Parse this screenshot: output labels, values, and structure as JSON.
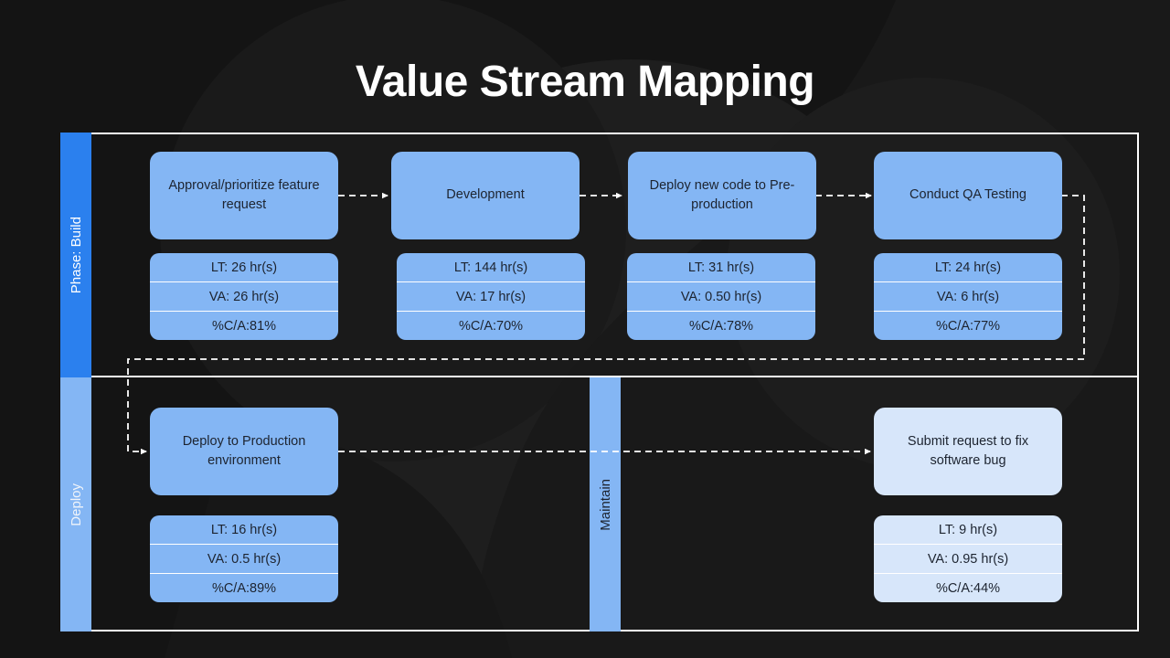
{
  "title": "Value Stream Mapping",
  "colors": {
    "background": "#141414",
    "band_build": "#2b80ee",
    "band_light": "#84b6f4",
    "box_primary": "#84b6f4",
    "box_light": "#d7e6fa",
    "frame_line": "#ffffff",
    "text_dark": "#1d2430",
    "connector": "#ffffff"
  },
  "bands": [
    {
      "id": "build",
      "label": "Phase: Build"
    },
    {
      "id": "deploy",
      "label": "Deploy"
    },
    {
      "id": "maintain",
      "label": "Maintain"
    }
  ],
  "steps": [
    {
      "id": "approval",
      "label": "Approval/prioritize feature request",
      "tone": "primary",
      "lane": "build",
      "metrics": {
        "lt": "LT: 26 hr(s)",
        "va": "VA: 26 hr(s)",
        "ca": "%C/A:81%"
      },
      "values": {
        "lead_time_hr": 26,
        "value_add_hr": 26,
        "complete_accurate_pct": 81
      }
    },
    {
      "id": "development",
      "label": "Development",
      "tone": "primary",
      "lane": "build",
      "metrics": {
        "lt": "LT: 144 hr(s)",
        "va": "VA: 17 hr(s)",
        "ca": "%C/A:70%"
      },
      "values": {
        "lead_time_hr": 144,
        "value_add_hr": 17,
        "complete_accurate_pct": 70
      }
    },
    {
      "id": "deploy-preprod",
      "label": "Deploy new code to Pre-production",
      "tone": "primary",
      "lane": "build",
      "metrics": {
        "lt": "LT: 31 hr(s)",
        "va": "VA: 0.50 hr(s)",
        "ca": "%C/A:78%"
      },
      "values": {
        "lead_time_hr": 31,
        "value_add_hr": 0.5,
        "complete_accurate_pct": 78
      }
    },
    {
      "id": "qa-testing",
      "label": "Conduct QA Testing",
      "tone": "primary",
      "lane": "build",
      "metrics": {
        "lt": "LT: 24 hr(s)",
        "va": "VA: 6 hr(s)",
        "ca": "%C/A:77%"
      },
      "values": {
        "lead_time_hr": 24,
        "value_add_hr": 6,
        "complete_accurate_pct": 77
      }
    },
    {
      "id": "deploy-production",
      "label": "Deploy to Production environment",
      "tone": "primary",
      "lane": "deploy",
      "metrics": {
        "lt": "LT: 16 hr(s)",
        "va": "VA: 0.5 hr(s)",
        "ca": "%C/A:89%"
      },
      "values": {
        "lead_time_hr": 16,
        "value_add_hr": 0.5,
        "complete_accurate_pct": 89
      }
    },
    {
      "id": "submit-bug",
      "label": "Submit request to fix software bug",
      "tone": "light",
      "lane": "maintain",
      "metrics": {
        "lt": "LT: 9 hr(s)",
        "va": "VA: 0.95 hr(s)",
        "ca": "%C/A:44%"
      },
      "values": {
        "lead_time_hr": 9,
        "value_add_hr": 0.95,
        "complete_accurate_pct": 44
      }
    }
  ],
  "connectors": [
    {
      "id": "approval-to-development",
      "style": "dashed",
      "arrow": true
    },
    {
      "id": "development-to-preprod",
      "style": "dashed",
      "arrow": true
    },
    {
      "id": "preprod-to-qa",
      "style": "dashed",
      "arrow": true
    },
    {
      "id": "qa-to-deploy-production",
      "style": "dashed",
      "arrow": true
    },
    {
      "id": "production-to-submit-bug",
      "style": "dashed",
      "arrow": true
    }
  ]
}
